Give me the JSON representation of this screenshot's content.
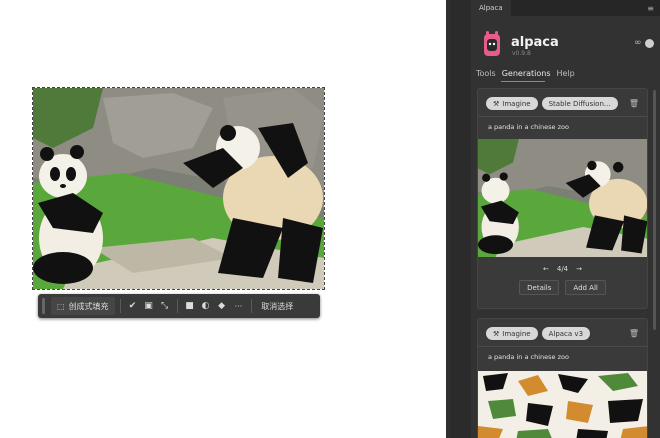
{
  "canvas": {
    "taskbar": {
      "generate_label": "创成式填充",
      "deselect_label": "取消选择",
      "more_label": "···"
    }
  },
  "panel": {
    "tab_title": "Alpaca",
    "app_name": "alpaca",
    "version": "v0.9.8",
    "nav": {
      "tools": "Tools",
      "generations": "Generations",
      "help": "Help"
    },
    "cards": [
      {
        "mode_label": "Imagine",
        "model_label": "Stable Diffusion...",
        "prompt": "a panda in a chinese zoo",
        "page": "4/4",
        "details_label": "Details",
        "add_all_label": "Add All"
      },
      {
        "mode_label": "Imagine",
        "model_label": "Alpaca v3",
        "prompt": "a panda in a chinese zoo"
      }
    ]
  },
  "colors": {
    "accent": "#e45b8a",
    "panel_bg": "#323232",
    "card_bg": "#3a3a3a"
  }
}
